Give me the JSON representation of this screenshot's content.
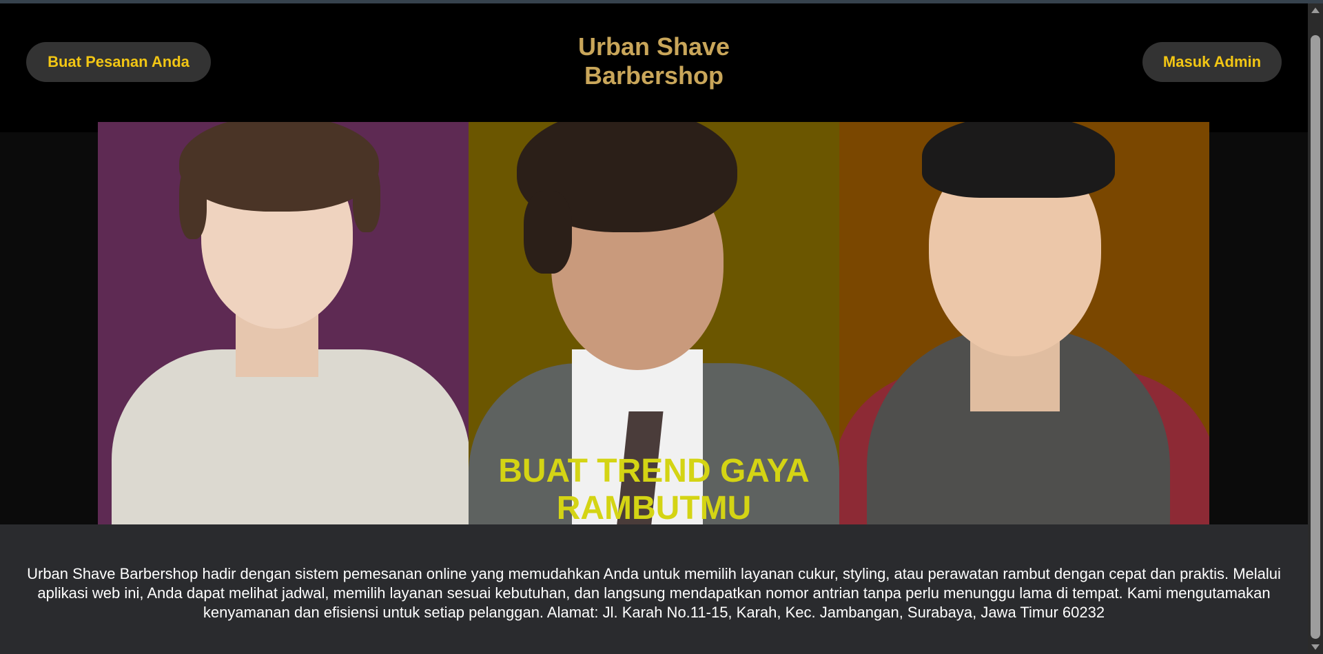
{
  "header": {
    "brand_line1": "Urban Shave",
    "brand_line2": "Barbershop",
    "order_button": "Buat Pesanan Anda",
    "admin_button": "Masuk Admin"
  },
  "hero": {
    "caption_line1": "BUAT TREND GAYA",
    "caption_line2": "RAMBUTMU",
    "panels": [
      {
        "name": "model-white-shirt",
        "background": "#5e2a53"
      },
      {
        "name": "model-suit",
        "background": "#6b5600"
      },
      {
        "name": "model-hoodie",
        "background": "#7a4700"
      }
    ]
  },
  "footer": {
    "description": "Urban Shave Barbershop hadir dengan sistem pemesanan online yang memudahkan Anda untuk memilih layanan cukur, styling, atau perawatan rambut dengan cepat dan praktis. Melalui aplikasi web ini, Anda dapat melihat jadwal, memilih layanan sesuai kebutuhan, dan langsung mendapatkan nomor antrian tanpa perlu menunggu lama di tempat. Kami mengutamakan kenyamanan dan efisiensi untuk setiap pelanggan. Alamat: Jl. Karah No.11-15, Karah, Kec. Jambangan, Surabaya, Jawa Timur 60232"
  },
  "colors": {
    "brand": "#c9a65a",
    "button_text": "#f2c614",
    "caption": "#d4d414"
  }
}
